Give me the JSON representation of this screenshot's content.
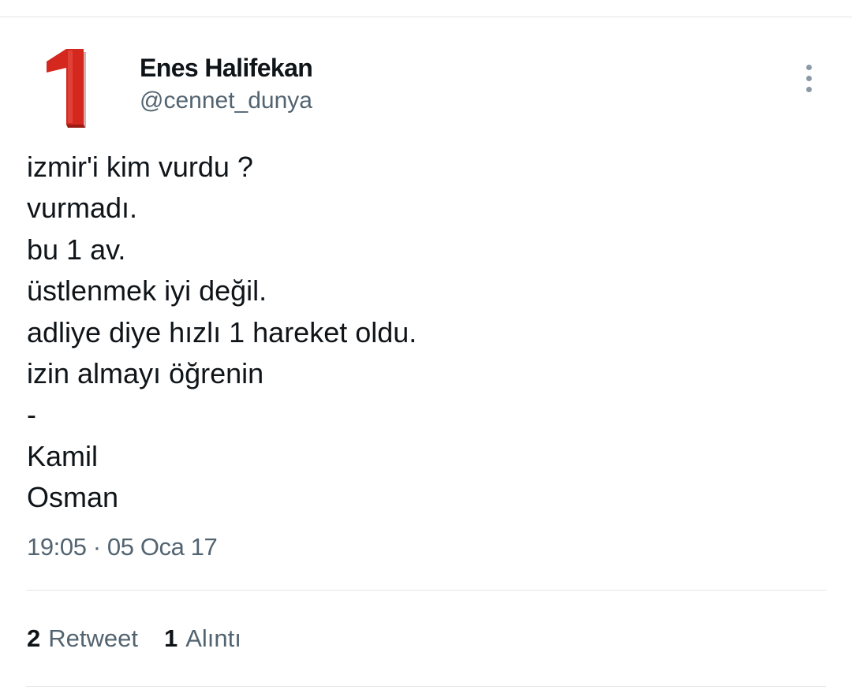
{
  "user": {
    "display_name": "Enes Halifekan",
    "handle": "@cennet_dunya",
    "avatar": {
      "icon": "red-number-one",
      "color": "#d4271e",
      "shadow": "#8e1712"
    }
  },
  "tweet": {
    "lines": [
      "izmir'i kim vurdu ?",
      "vurmadı.",
      "bu 1 av.",
      "üstlenmek iyi değil.",
      "adliye diye hızlı 1 hareket oldu.",
      "izin almayı öğrenin",
      "-",
      "Kamil",
      "Osman"
    ],
    "timestamp": "19:05 · 05 Oca 17"
  },
  "stats": {
    "retweets": {
      "count": "2",
      "label": "Retweet"
    },
    "quotes": {
      "count": "1",
      "label": "Alıntı"
    }
  },
  "menu": {
    "icon": "more-vertical-icon"
  },
  "colors": {
    "text": "#0f1419",
    "secondary": "#536471",
    "divider": "#e1e5e8"
  }
}
